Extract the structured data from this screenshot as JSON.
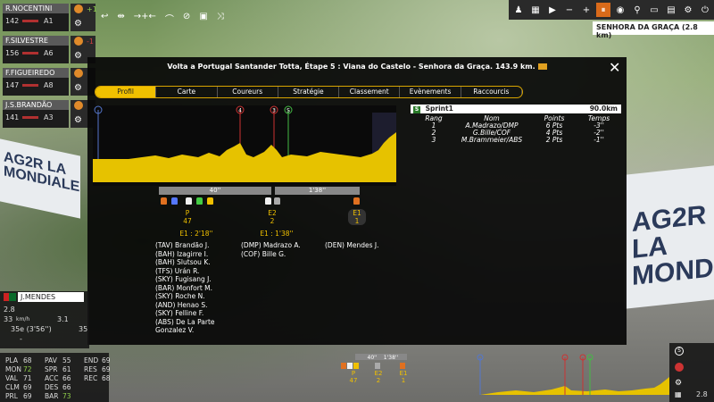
{
  "riders": [
    {
      "name": "R.NOCENTINI",
      "number": "142",
      "category": "A1",
      "diff": "+1",
      "diff_color": "#8fcf4a"
    },
    {
      "name": "F.SILVESTRE",
      "number": "156",
      "category": "A6",
      "diff": "-1",
      "diff_color": "#d04040"
    },
    {
      "name": "F.FIGUEIREDO",
      "number": "147",
      "category": "A8",
      "diff": "",
      "diff_color": "#ddd"
    },
    {
      "name": "J.S.BRANDÃO",
      "number": "141",
      "category": "A3",
      "diff": "",
      "diff_color": "#ddd"
    }
  ],
  "location": "SENHORA DA GRAÇA (2.8 km)",
  "panel": {
    "title": "Volta a Portugal Santander Totta, Étape 5 : Viana do Castelo - Senhora da Graça. 143.9 km.",
    "close": "✕",
    "tabs": [
      "Profil",
      "Carte",
      "Coureurs",
      "Stratégie",
      "Classement",
      "Evènements",
      "Raccourcis clavier"
    ],
    "active_tab": 0
  },
  "profile_markers": [
    "4",
    "3",
    "S"
  ],
  "gaps": [
    "40''",
    "1'38''"
  ],
  "groups": [
    {
      "label": "P",
      "count": "47"
    },
    {
      "label": "E2",
      "count": "2"
    },
    {
      "label": "E1",
      "count": "1"
    }
  ],
  "group_times": [
    "E1 : 2'18''",
    "E1 : 1'38''"
  ],
  "group_names": {
    "col1": [
      "(TAV) Brandão J.",
      "(BAH) Izagirre I.",
      "(BAH) Slutsou K.",
      "(TFS) Urán R.",
      "(SKY) Fugisang J.",
      "(BAR) Monfort M.",
      "(SKY) Roche N.",
      "(AND) Henao S.",
      "(SKY) Felline F.",
      "(ABS) De La Parte Gonzalez V."
    ],
    "col2": [
      "(DMP) Madrazo A.",
      "(COF) Bille G."
    ],
    "col3": [
      "(DEN) Mendes J."
    ]
  },
  "sprint": {
    "icon": "S",
    "name": "Sprint1",
    "distance": "90.0km",
    "headers": [
      "Rang",
      "Nom",
      "Points",
      "Temps"
    ],
    "rows": [
      [
        "1",
        "A.Madrazo/DMP",
        "6 Pts",
        "-3''"
      ],
      [
        "2",
        "G.Bille/COF",
        "4 Pts",
        "-2''"
      ],
      [
        "3",
        "M.Brammeier/ABS",
        "2 Pts",
        "-1''"
      ]
    ]
  },
  "rider_detail": {
    "name": "J.MENDES",
    "power": "2.8",
    "speed": "33",
    "speed_unit": "km/h",
    "gradient": "3.1",
    "position": "35e (3'56'')",
    "other": "-",
    "side_num": "35"
  },
  "stats": [
    {
      "label": "PLA",
      "value": "68",
      "green": false
    },
    {
      "label": "MON",
      "value": "72",
      "green": true
    },
    {
      "label": "VAL",
      "value": "71",
      "green": false
    },
    {
      "label": "CLM",
      "value": "69",
      "green": false
    },
    {
      "label": "PRL",
      "value": "69",
      "green": false
    },
    {
      "label": "PAV",
      "value": "55",
      "green": false
    },
    {
      "label": "SPR",
      "value": "61",
      "green": false
    },
    {
      "label": "ACC",
      "value": "66",
      "green": false
    },
    {
      "label": "DES",
      "value": "66",
      "green": false
    },
    {
      "label": "BAR",
      "value": "73",
      "green": true
    },
    {
      "label": "END",
      "value": "69",
      "green": false
    },
    {
      "label": "RES",
      "value": "69",
      "green": false
    },
    {
      "label": "REC",
      "value": "68",
      "green": false
    }
  ],
  "mini": {
    "gaps": [
      "40''",
      "1'38''"
    ],
    "groups": [
      {
        "label": "P",
        "count": "47"
      },
      {
        "label": "E2",
        "count": "2"
      },
      {
        "label": "E1",
        "count": "1"
      }
    ],
    "remaining": "2.8"
  },
  "colors": {
    "accent": "#f0c000",
    "profile_fill": "#e6c200",
    "play": "#d96a1a"
  }
}
